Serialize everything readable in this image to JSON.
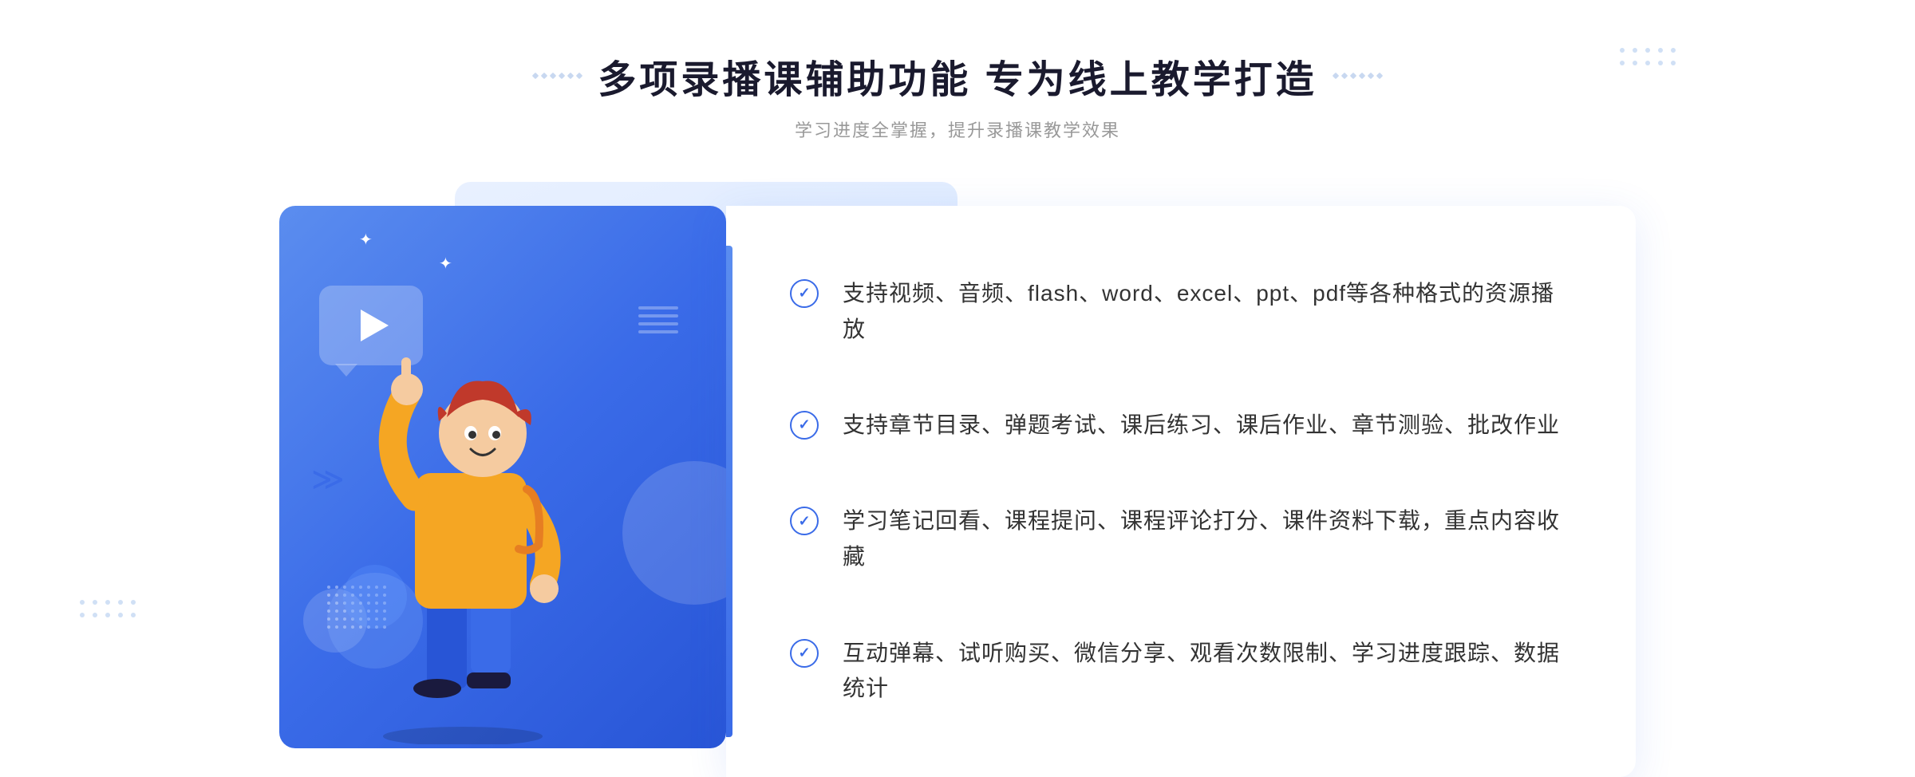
{
  "header": {
    "title": "多项录播课辅助功能 专为线上教学打造",
    "subtitle": "学习进度全掌握，提升录播课教学效果",
    "decorator_left": "decorators",
    "decorator_right": "decorators"
  },
  "features": [
    {
      "id": 1,
      "text": "支持视频、音频、flash、word、excel、ppt、pdf等各种格式的资源播放"
    },
    {
      "id": 2,
      "text": "支持章节目录、弹题考试、课后练习、课后作业、章节测验、批改作业"
    },
    {
      "id": 3,
      "text": "学习笔记回看、课程提问、课程评论打分、课件资料下载，重点内容收藏"
    },
    {
      "id": 4,
      "text": "互动弹幕、试听购买、微信分享、观看次数限制、学习进度跟踪、数据统计"
    }
  ],
  "colors": {
    "primary_blue": "#3a6be8",
    "light_blue": "#5b8def",
    "bg_blue": "#d0e4ff",
    "text_dark": "#1a1a2e",
    "text_gray": "#333333",
    "text_light": "#999999"
  }
}
